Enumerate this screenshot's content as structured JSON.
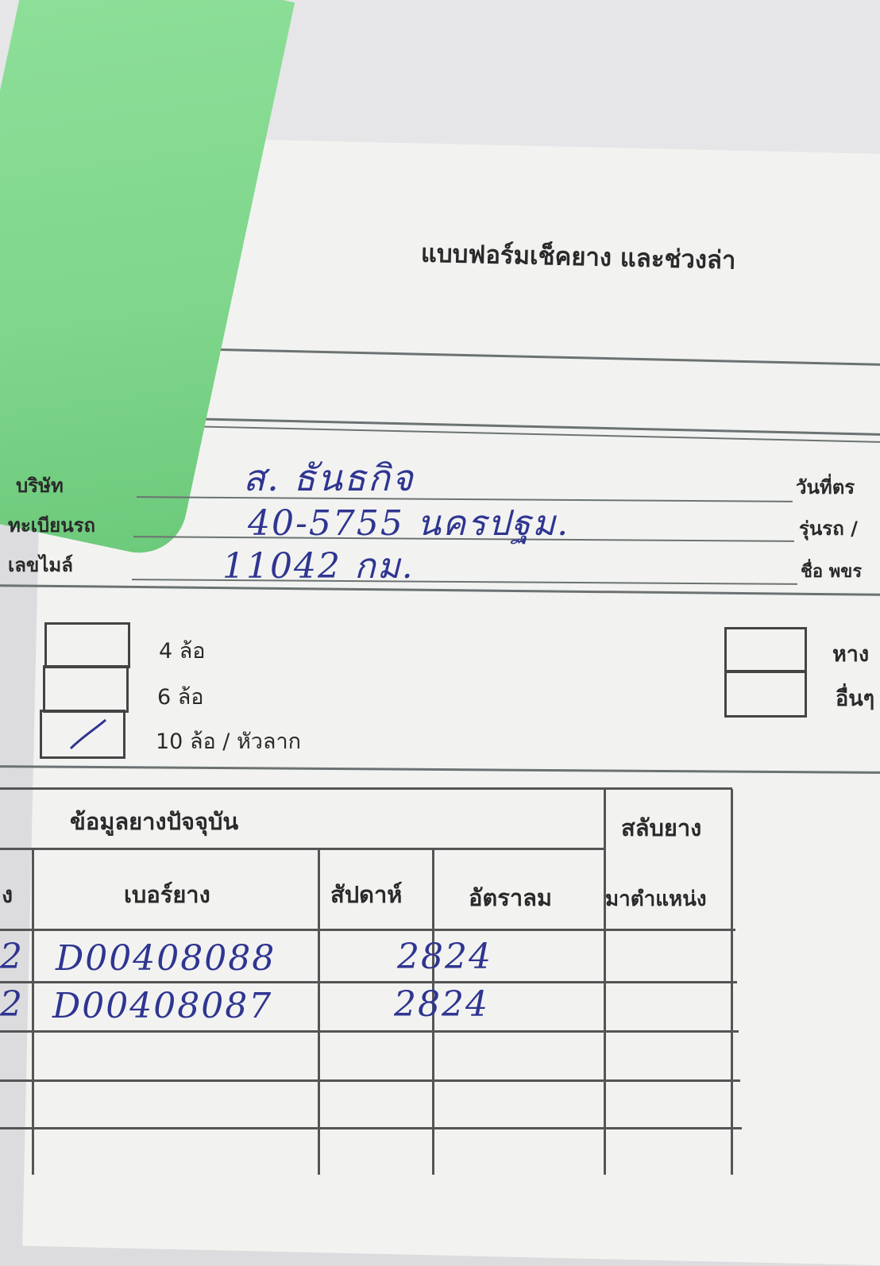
{
  "form": {
    "title": "แบบฟอร์มเช็คยาง และช่วงล่า"
  },
  "fields": {
    "company_label": "บริษัท",
    "company_value": "ส. ธันธกิจ",
    "plate_label": "ทะเบียนรถ",
    "plate_value": "40-5755 นครปฐม.",
    "mileage_label": "เลขไมล์",
    "mileage_value": "11042 กม.",
    "date_label": "วันที่ตร",
    "model_label": "รุ่นรถ /",
    "staff_label": "ชื่อ พขร"
  },
  "vehicle_types": {
    "left": [
      {
        "label": "4 ล้อ",
        "checked": false
      },
      {
        "label": "6 ล้อ",
        "checked": false
      },
      {
        "label": "10 ล้อ / หัวลาก",
        "checked": true
      }
    ],
    "right": [
      {
        "label": "หาง",
        "checked": false
      },
      {
        "label": "อื่นๆ",
        "checked": false
      }
    ]
  },
  "table": {
    "group_header": "ข้อมูลยางปัจจุบัน",
    "swap_header_1": "สลับยาง",
    "swap_header_2": "มาตำแหน่ง",
    "columns": [
      "ง",
      "เบอร์ยาง",
      "สัปดาห์",
      "อัตราลม"
    ],
    "rows": [
      {
        "pos": "2",
        "tire_no": "D00408088",
        "week": "2824"
      },
      {
        "pos": "2",
        "tire_no": "D00408087",
        "week": "2824"
      }
    ]
  },
  "colors": {
    "ink": "#2f3590",
    "paper": "#f2f3f1",
    "cover": "#7fd68c"
  }
}
